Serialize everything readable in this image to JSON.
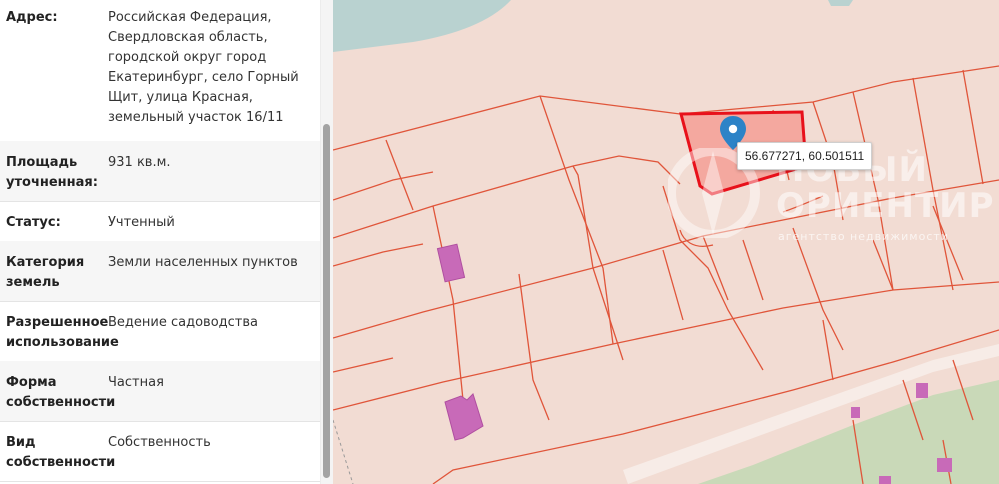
{
  "parcel_info": {
    "rows": [
      {
        "label": "Адрес:",
        "value": "Российская Федерация, Свердловская область, городской округ город Екатеринбург, село Горный Щит, улица Красная, земельный участок 16/11"
      },
      {
        "label": "Площадь уточненная:",
        "value": "931 кв.м."
      },
      {
        "label": "Статус:",
        "value": "Учтенный"
      },
      {
        "label": "Категория земель",
        "value": "Земли населенных пунктов"
      },
      {
        "label": "Разрешенное использование",
        "value": "Ведение садоводства"
      },
      {
        "label": "Форма собственности",
        "value": "Частная"
      },
      {
        "label": "Вид собственности",
        "value": "Собственность"
      }
    ]
  },
  "map": {
    "coordinates_label": "56.677271, 60.501511",
    "marker_icon": "map-pin-icon",
    "colors": {
      "land": "#f2dcd3",
      "water": "#b9d2d0",
      "parcel_lines": "#e0553a",
      "selected_fill": "#f4a89f",
      "selected_border": "#e8111b",
      "buildings": "#c86ab8",
      "forest": "#c9d9b8",
      "marker": "#2d83c7"
    },
    "watermark": {
      "line1": "НОВЫЙ",
      "line2": "ОРИЕНТИР",
      "tagline": "агентство недвижимости"
    }
  }
}
